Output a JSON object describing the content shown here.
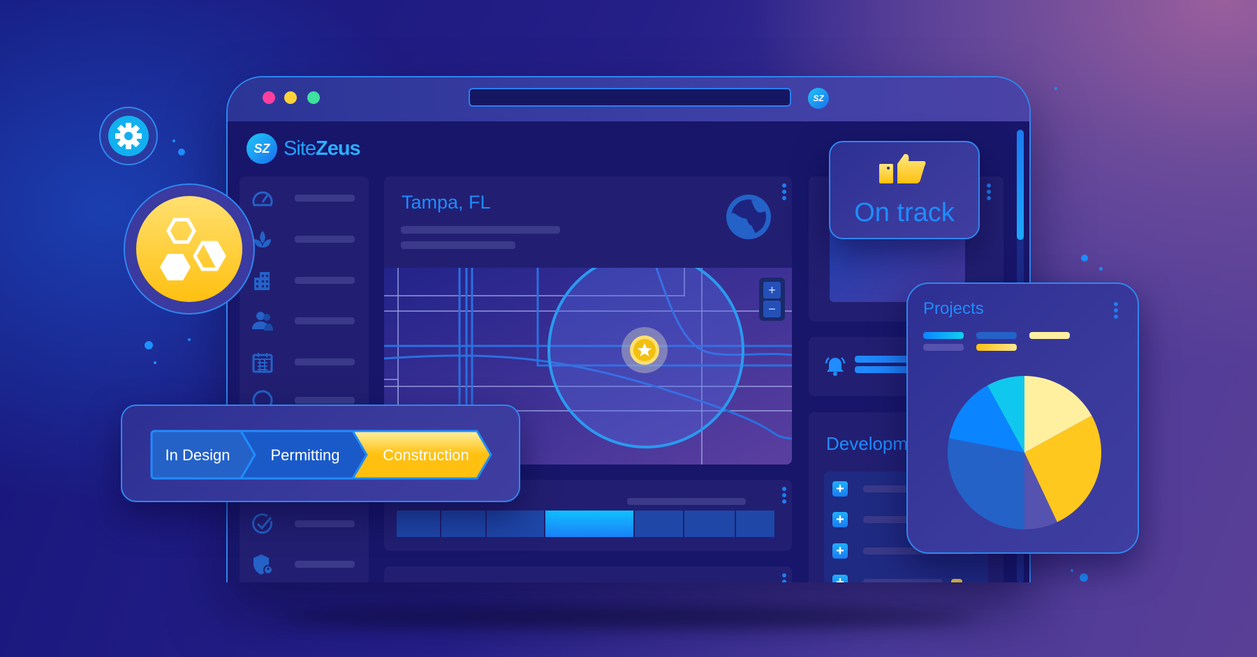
{
  "app": {
    "brand_prefix": "Site",
    "brand_suffix": "Zeus",
    "logo_mark": "SZ"
  },
  "window": {
    "controls": [
      {
        "name": "close",
        "color": "#ff3fa0"
      },
      {
        "name": "minimize",
        "color": "#ffd23a"
      },
      {
        "name": "maximize",
        "color": "#3fe0a0"
      }
    ]
  },
  "sidebar": {
    "icons": [
      "gauge-icon",
      "plant-icon",
      "building-icon",
      "users-icon",
      "calendar-icon",
      "globe-icon",
      "check-circle-icon",
      "shield-user-icon"
    ]
  },
  "location_card": {
    "title": "Tampa, FL",
    "zoom_in": "+",
    "zoom_out": "−"
  },
  "status_card": {
    "label": "On track",
    "icon": "thumbs-up-icon"
  },
  "development_card": {
    "title": "Developm"
  },
  "projects_card": {
    "title": "Projects",
    "pie_slices": [
      {
        "fraction": 0.17,
        "color": "#fff0a0"
      },
      {
        "fraction": 0.26,
        "color": "#ffc81e"
      },
      {
        "fraction": 0.07,
        "color": "#5552b0"
      },
      {
        "fraction": 0.28,
        "color": "#2462c8"
      },
      {
        "fraction": 0.14,
        "color": "#0a85ff"
      },
      {
        "fraction": 0.08,
        "color": "#10c8ee"
      }
    ]
  },
  "pipeline": {
    "steps": [
      {
        "label": "In Design",
        "state": "done"
      },
      {
        "label": "Permitting",
        "state": "done"
      },
      {
        "label": "Construction",
        "state": "current"
      }
    ]
  },
  "colors": {
    "accent": "#1f7df0",
    "highlight": "#ffc81e",
    "background": "#1c1a7a"
  }
}
